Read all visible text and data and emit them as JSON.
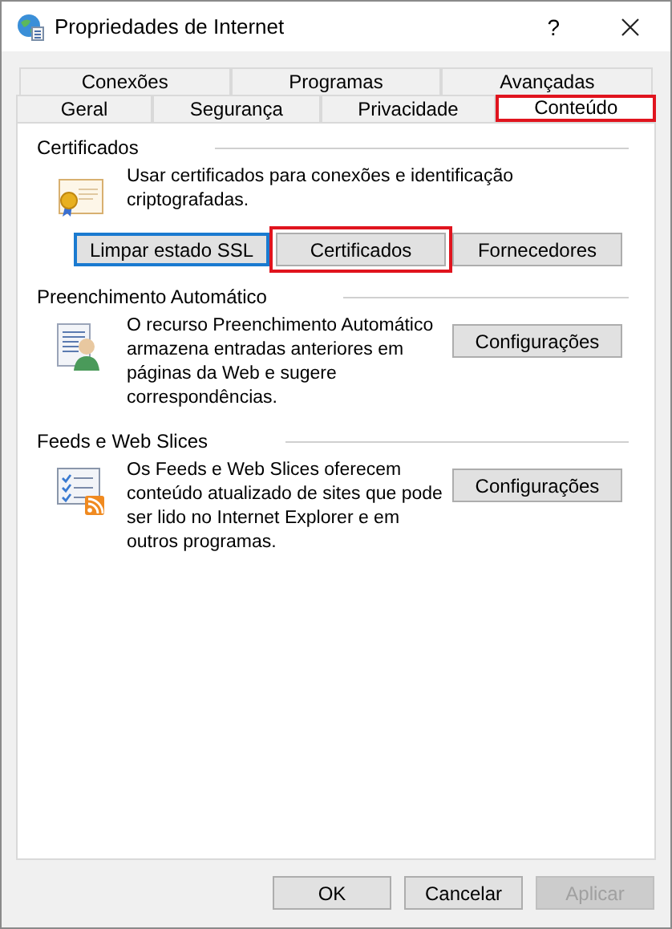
{
  "window": {
    "title": "Propriedades de Internet",
    "help_button": "?"
  },
  "tab_rows": [
    {
      "tabs": [
        {
          "label": "Conexões",
          "selected": false,
          "highlighted": false
        },
        {
          "label": "Programas",
          "selected": false,
          "highlighted": false
        },
        {
          "label": "Avançadas",
          "selected": false,
          "highlighted": false
        }
      ]
    },
    {
      "tabs": [
        {
          "label": "Geral",
          "selected": false,
          "highlighted": false
        },
        {
          "label": "Segurança",
          "selected": false,
          "highlighted": false
        },
        {
          "label": "Privacidade",
          "selected": false,
          "highlighted": false
        },
        {
          "label": "Conteúdo",
          "selected": true,
          "highlighted": true
        }
      ]
    }
  ],
  "sections": [
    {
      "kind": "certificates",
      "title": "Certificados",
      "description": "Usar certificados para conexões e identificação criptografadas.",
      "buttons": [
        {
          "label": "Limpar estado SSL",
          "focused": true,
          "highlighted": false
        },
        {
          "label": "Certificados",
          "focused": false,
          "highlighted": true
        },
        {
          "label": "Fornecedores",
          "focused": false,
          "highlighted": false
        }
      ]
    },
    {
      "kind": "autocomplete",
      "title": "Preenchimento Automático",
      "description": "O recurso Preenchimento Automático armazena entradas anteriores em páginas da Web e sugere correspondências.",
      "buttons": [
        {
          "label": "Configurações",
          "focused": false,
          "highlighted": false
        }
      ]
    },
    {
      "kind": "feeds",
      "title": "Feeds e Web Slices",
      "description": "Os Feeds e Web Slices oferecem conteúdo atualizado de sites que pode ser lido no Internet Explorer e em outros programas.",
      "buttons": [
        {
          "label": "Configurações",
          "focused": false,
          "highlighted": false
        }
      ]
    }
  ],
  "footer_buttons": [
    {
      "label": "OK",
      "disabled": false
    },
    {
      "label": "Cancelar",
      "disabled": false
    },
    {
      "label": "Aplicar",
      "disabled": true
    }
  ]
}
